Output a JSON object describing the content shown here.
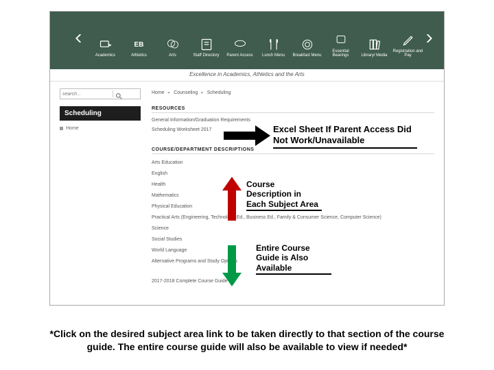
{
  "nav": {
    "items": [
      {
        "label": "Academics"
      },
      {
        "label": "Athletics"
      },
      {
        "label": "Arts"
      },
      {
        "label": "Staff Directory"
      },
      {
        "label": "Parent Access"
      },
      {
        "label": "Lunch Menu"
      },
      {
        "label": "Breakfast Menu"
      },
      {
        "label": "Essential Bearings"
      },
      {
        "label": "Library/ Media"
      },
      {
        "label": "Registration and Pay"
      }
    ]
  },
  "tagline": "Excellence in Academics, Athletics and the Arts",
  "search": {
    "placeholder": "search..."
  },
  "sidebar": {
    "title": "Scheduling",
    "home": "Home"
  },
  "breadcrumb": {
    "a": "Home",
    "b": "Counseling",
    "c": "Scheduling"
  },
  "resources": {
    "heading": "RESOURCES",
    "items": [
      "General Information/Graduation Requirements",
      "Scheduling Worksheet 2017"
    ]
  },
  "departments": {
    "heading": "COURSE/DEPARTMENT DESCRIPTIONS",
    "items": [
      "Arts Education",
      "English",
      "Health",
      "Mathematics",
      "Physical Education",
      "Practical Arts (Engineering, Technology Ed., Business Ed., Family & Consumer Science, Computer Science)",
      "Science",
      "Social Studies",
      "World Language",
      "Alternative Programs and Study Options"
    ]
  },
  "course_guide": "2017-2018 Complete Course Guide",
  "callouts": {
    "c1": "Excel Sheet If Parent Access Did Not Work/Unavailable",
    "c2": "Course Description in Each Subject Area",
    "c3": "Entire Course Guide is Also Available"
  },
  "footnote": "*Click on the desired subject area link to be taken directly to that section of the course guide. The entire course guide will also be available to view if needed*"
}
